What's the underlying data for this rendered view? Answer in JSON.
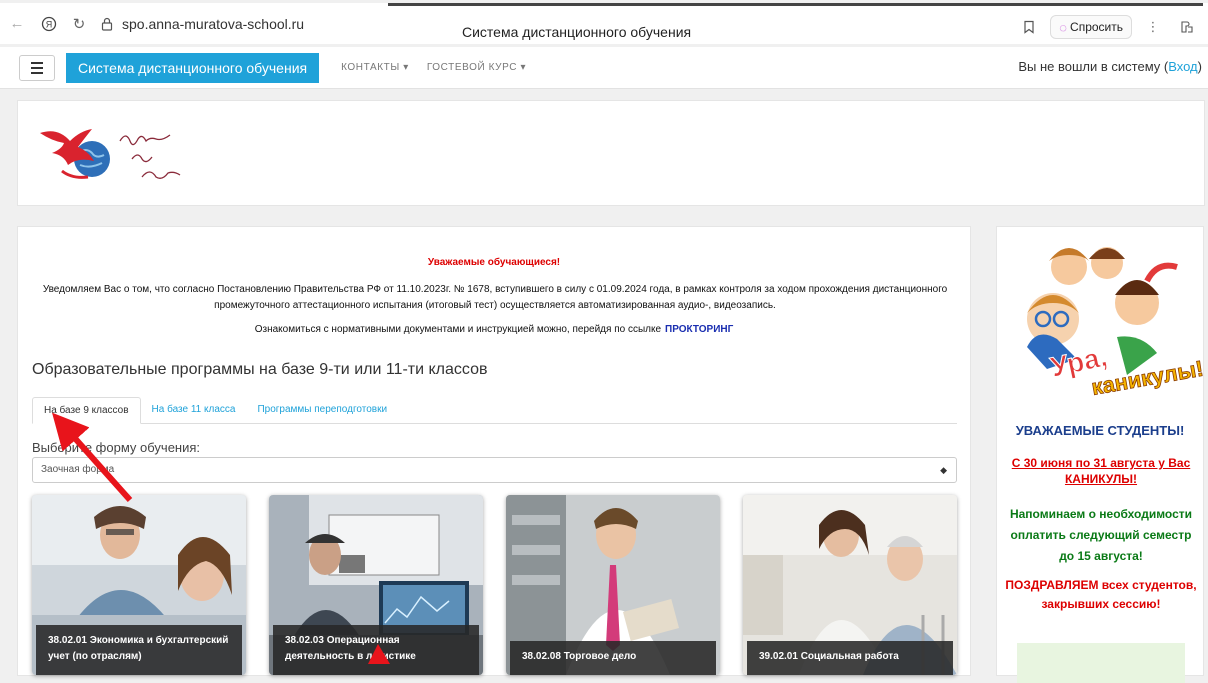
{
  "browser": {
    "url": "spo.anna-muratova-school.ru",
    "title": "Система дистанционного обучения",
    "ask_label": "Спросить"
  },
  "navbar": {
    "brand": "Система дистанционного обучения",
    "links": [
      "КОНТАКТЫ ▾",
      "ГОСТЕВОЙ КУРС ▾"
    ],
    "login_text": "Вы не вошли в систему (",
    "login_link": "Вход",
    "login_close": ")"
  },
  "notice": {
    "title": "Уважаемые обучающиеся!",
    "line1": "Уведомляем Вас о том, что согласно Постановлению Правительства РФ от 11.10.2023г. № 1678, вступившего в силу с 01.09.2024 года, в рамках контроля за ходом прохождения дистанционного",
    "line2": "промежуточного аттестационного испытания (итоговый тест) осуществляется автоматизированная аудио-, видеозапись.",
    "link_text": "Ознакомиться с нормативными документами и инструкцией можно, перейдя по ссылке",
    "link_label": "ПРОКТОРИНГ"
  },
  "programs": {
    "title": "Образовательные программы на базе 9-ти или 11-ти классов",
    "tabs": [
      "На базе 9 классов",
      "На базе 11 класса",
      "Программы переподготовки"
    ],
    "form_label": "Выберите форму обучения:",
    "selected_form": "Заочная форма",
    "cards": [
      {
        "label": "38.02.01 Экономика и бухгалтерский учет (по отраслям)"
      },
      {
        "label": "38.02.03 Операционная деятельность в логистике"
      },
      {
        "label": "38.02.08 Торговое дело"
      },
      {
        "label": "39.02.01 Социальная работа"
      }
    ]
  },
  "sidebar": {
    "banner_text": "Ура, каникулы!",
    "title": "УВАЖАЕМЫЕ СТУДЕНТЫ!",
    "red_text": "С 30 июня по 31 августа у Вас КАНИКУЛЫ!",
    "green_text": "Напоминаем о необходимости оплатить следующий семестр до 15 августа!",
    "congrats": "ПОЗДРАВЛЯЕМ всех студентов, закрывших сессию!"
  }
}
